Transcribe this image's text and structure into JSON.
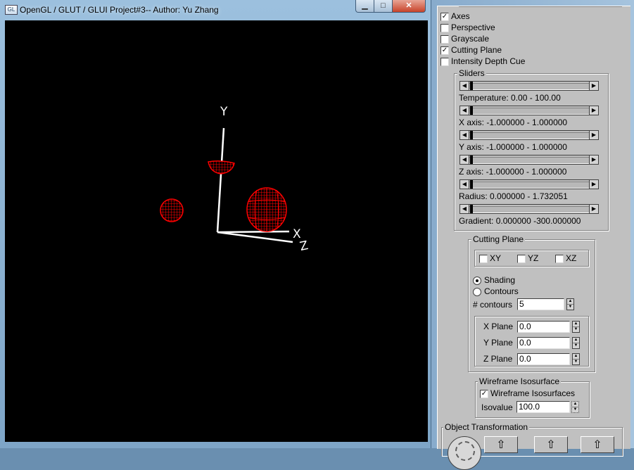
{
  "gl_window": {
    "title": "OpenGL / GLUT / GLUI Project#3-- Author: Yu Zhang",
    "controls": {
      "minimize": "▁",
      "maximize": "□",
      "close": "✕"
    }
  },
  "scene": {
    "axis_labels": {
      "x": "X",
      "y": "Y",
      "z": "Z"
    },
    "background": "#000000",
    "axis_color": "#ffffff",
    "isosurface_color": "#ff0000"
  },
  "panel": {
    "checkboxes": [
      {
        "label": "Axes",
        "checked": true
      },
      {
        "label": "Perspective",
        "checked": false
      },
      {
        "label": "Grayscale",
        "checked": false
      },
      {
        "label": "Cutting Plane",
        "checked": true
      },
      {
        "label": "Intensity Depth Cue",
        "checked": false
      }
    ],
    "sliders_group": {
      "title": "Sliders",
      "sliders": [
        {
          "label": "Temperature:  0.00 - 100.00"
        },
        {
          "label": "X axis: -1.000000 - 1.000000"
        },
        {
          "label": "Y axis: -1.000000 - 1.000000"
        },
        {
          "label": "Z axis: -1.000000 - 1.000000"
        },
        {
          "label": "Radius: 0.000000 - 1.732051"
        },
        {
          "label": "Gradient: 0.000000 -300.000000"
        }
      ]
    },
    "cutting_plane": {
      "title": "Cutting Plane",
      "planes": [
        {
          "label": "XY",
          "checked": false
        },
        {
          "label": "YZ",
          "checked": false
        },
        {
          "label": "XZ",
          "checked": false
        }
      ],
      "modes": [
        {
          "label": "Shading",
          "selected": true
        },
        {
          "label": "Contours",
          "selected": false
        }
      ],
      "contours_label": "# contours",
      "contours_value": "5",
      "planes_values": [
        {
          "label": "X Plane",
          "value": "0.0"
        },
        {
          "label": "Y Plane",
          "value": "0.0"
        },
        {
          "label": "Z Plane",
          "value": "0.0"
        }
      ]
    },
    "wireframe": {
      "title": "Wireframe Isosurface",
      "checkbox_label": "Wireframe Isosurfaces",
      "checked": true,
      "isovalue_label": "Isovalue",
      "isovalue": "100.0"
    },
    "object_transformation": {
      "title": "Object Transformation"
    }
  }
}
